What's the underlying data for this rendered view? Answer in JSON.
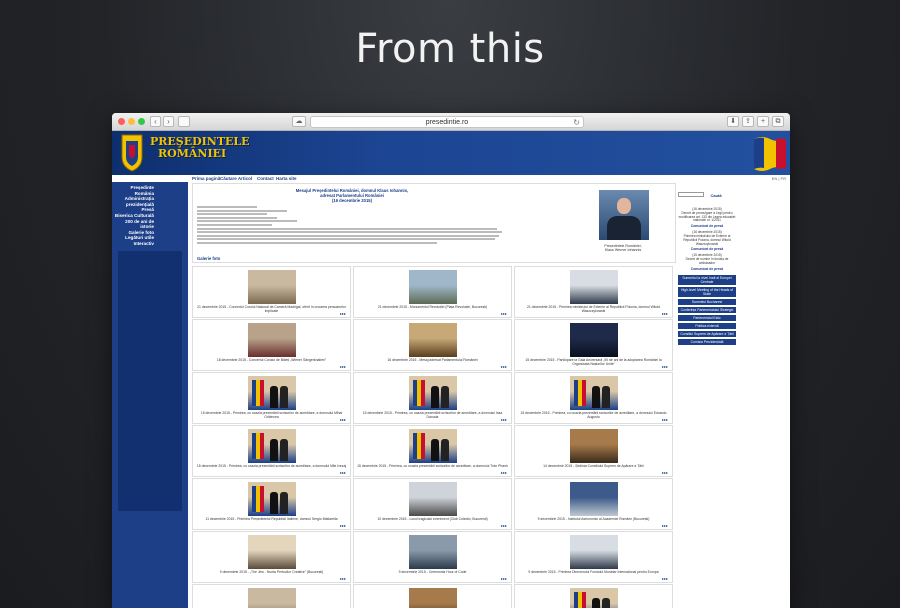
{
  "hero": {
    "title": "From this"
  },
  "browser": {
    "url": "presedintie.ro",
    "nav_back": "‹",
    "nav_forward": "›",
    "reload": "↻",
    "share": "⇪",
    "tabs": "⧉",
    "plus": "+"
  },
  "site": {
    "title_line1": "PREŞEDINTELE",
    "title_line2": "ROMÂNIEI",
    "topnav": [
      "Prima pagină",
      "Căutare Articol",
      "Contact",
      "Harta site"
    ],
    "langs": "EN | FR",
    "left_nav": [
      "Președinte",
      "România",
      "Administrația prezidențială",
      "Presă",
      "Biserica Culturală",
      "200 de ani de istorie",
      "Galerie foto",
      "Legături utile",
      "Interactiv"
    ],
    "intro_title_1": "Mesajul Președintelui României, domnul Klaus Iohannis,",
    "intro_title_2": "adresat Parlamentului României",
    "intro_title_3": "(16 decembrie 2015)",
    "portrait_caption_1": "Președintele României,",
    "portrait_caption_2": "Klaus Werner Iohannis",
    "gallery_link": "Galerie foto",
    "right_search_button": "Caută",
    "right_news": [
      {
        "date": "(16 decembrie 2015)",
        "text": "Decret de promulgare a Legii pentru modificarea art. 133 din Legea educației naționale nr. 1/2011",
        "link": "Comunicat de presă"
      },
      {
        "date": "(16 decembrie 2015)",
        "text": "Primirea ministrului de Externe al Republicii Polonia, domnul Witold Waszczykowski",
        "link": "Comunicat de presă"
      },
      {
        "date": "(15 decembrie 2015)",
        "text": "Decret de numire în funcția de ambasador",
        "link": "Comunicat de presă"
      }
    ],
    "right_buttons": [
      "Summitul la nivel înalt al Europei Centrale",
      "High-level Meeting of the Heads of State",
      "Summitul Bucharest",
      "Conferința Parteneriatului Strategic",
      "Parteneriatul Estic",
      "Politica externă",
      "Consiliul Suprem de Apărare a Țării",
      "Comisia Prezidențială"
    ]
  },
  "gallery": [
    {
      "caption": "21 decembrie 2015 - Concertul Corului Național de Cameră Madrigal, oferit în onoarea persoanelor implicate",
      "more": "▸▸▸",
      "thumb": "hall"
    },
    {
      "caption": "21 decembrie 2015 - Monumentul Revoluției (Piața Revoluției, București)",
      "more": "▸▸▸",
      "thumb": "outdoor"
    },
    {
      "caption": "21 decembrie 2015 - Primirea ministrului de Externe al Republicii Polonia, domnul Witold Waszczykowski",
      "more": "▸▸▸",
      "thumb": "handshake"
    },
    {
      "caption": "18 decembrie 2015 - Concertul Corului de Băieți „Wiener Sängerknaben”",
      "more": "▸▸▸",
      "thumb": "choir"
    },
    {
      "caption": "16 decembrie 2015 - Mesaj adresat Parlamentului României",
      "more": "▸▸▸",
      "thumb": "parliament"
    },
    {
      "caption": "15 decembrie 2015 - Participare la Gala Aniversară „90 de ani de la adoptarea României la Organizația Națiunilor Unite”",
      "more": "▸▸▸",
      "thumb": "stage"
    },
    {
      "caption": "15 decembrie 2015 - Primirea, cu ocazia prezentării scrisorilor de acreditare, a domnului Mihai Gribincea",
      "more": "▸▸▸",
      "thumb": "flags"
    },
    {
      "caption": "15 decembrie 2015 - Primirea, cu ocazia prezentării scrisorilor de acreditare, a domnului Issa Daouda",
      "more": "▸▸▸",
      "thumb": "flags"
    },
    {
      "caption": "15 decembrie 2015 - Primirea, cu ocazia prezentării scrisorilor de acreditare, a domnului Eduardo Augusto",
      "more": "▸▸▸",
      "thumb": "flags"
    },
    {
      "caption": "15 decembrie 2015 - Primirea, cu ocazia prezentării scrisorilor de acreditare, a domnului Mile Ivezaj",
      "more": "▸▸▸",
      "thumb": "flags"
    },
    {
      "caption": "15 decembrie 2015 - Primirea, cu ocazia prezentării scrisorilor de acreditare, a domnului Tran Phanh",
      "more": "▸▸▸",
      "thumb": "flags"
    },
    {
      "caption": "14 decembrie 2015 - Ședința Consiliului Suprem de Apărare a Țării",
      "more": "▸▸▸",
      "thumb": "meeting"
    },
    {
      "caption": "11 decembrie 2015 - Primirea Președintelui Republicii Italiene, domnul Sergio Mattarella",
      "more": "▸▸▸",
      "thumb": "flags"
    },
    {
      "caption": "10 decembrie 2015 - Locul tragicului eveniment (Club Colectiv, București)",
      "more": "▸▸▸",
      "thumb": "memorial"
    },
    {
      "caption": "9 decembrie 2015 - Institutul Astronomic al Academiei Române (București)",
      "more": "▸▸▸",
      "thumb": "dome"
    },
    {
      "caption": "9 decembrie 2015 - „The Jew - Nunta Perfuzilor Creative” (București)",
      "more": "▸▸▸",
      "thumb": "exhibit"
    },
    {
      "caption": "9 decembrie 2015 - Ceremonia Hour of Code",
      "more": "▸▸▸",
      "thumb": "classroom"
    },
    {
      "caption": "9 decembrie 2015 - Primirea Directorului Fondului Monetar Internațional pentru Europa",
      "more": "▸▸▸",
      "thumb": "handshake"
    },
    {
      "caption": "",
      "more": "",
      "thumb": "hall"
    },
    {
      "caption": "",
      "more": "",
      "thumb": "meeting"
    },
    {
      "caption": "",
      "more": "",
      "thumb": "flags"
    }
  ]
}
